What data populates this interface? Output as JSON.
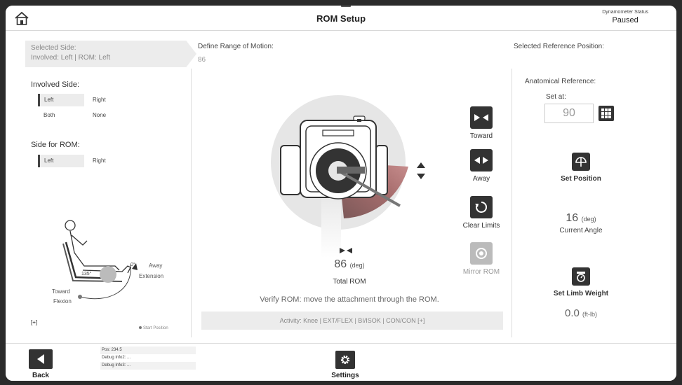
{
  "header": {
    "title": "ROM Setup",
    "dynamometer_label": "Dynamometer Status",
    "dynamometer_status": "Paused"
  },
  "selected_side": {
    "label": "Selected Side:",
    "value": "Involved: Left | ROM: Left"
  },
  "define_rom": {
    "label": "Define Range of Motion:",
    "value": "86"
  },
  "selected_reference": {
    "label": "Selected Reference Position:"
  },
  "involved_side": {
    "title": "Involved Side:",
    "options": [
      "Left",
      "Right",
      "Both",
      "None"
    ],
    "selected": "Left"
  },
  "side_for_rom": {
    "title": "Side for ROM:",
    "options": [
      "Left",
      "Right"
    ],
    "selected": "Left"
  },
  "leg_diagram": {
    "zero_label": "0°",
    "max_label": "135°",
    "away_label": "Away",
    "extension_label": "Extension",
    "toward_label": "Toward",
    "flexion_label": "Flexion"
  },
  "left_plus": "[+]",
  "start_position_label": "Start Position",
  "center_buttons": {
    "toward": "Toward",
    "away": "Away",
    "clear_limits": "Clear Limits",
    "mirror_rom": "Mirror ROM"
  },
  "total_rom": {
    "value": "86",
    "unit": "(deg)",
    "label": "Total ROM"
  },
  "verify_text": "Verify ROM: move the attachment through the ROM.",
  "activity_text": "Activity:  Knee | EXT/FLEX | BI/ISOK | CON/CON  [+]",
  "anatomical_reference": {
    "title": "Anatomical Reference:",
    "set_at_label": "Set at:",
    "set_at_value": "90"
  },
  "set_position_label": "Set Position",
  "current_angle": {
    "value": "16",
    "unit": "(deg)",
    "label": "Current Angle"
  },
  "limb_weight": {
    "button_label": "Set Limb Weight",
    "value": "0.0",
    "unit": "(ft-lb)"
  },
  "footer": {
    "back_label": "Back",
    "settings_label": "Settings",
    "debug": [
      "Pos: 234.5",
      "Debug Info2: ...",
      "Debug Info3: ..."
    ]
  },
  "colors": {
    "dark_button": "#333333",
    "rom_arc_light": "#c98f8f",
    "rom_arc_dark": "#7a5858",
    "panel_grey": "#ececec"
  }
}
